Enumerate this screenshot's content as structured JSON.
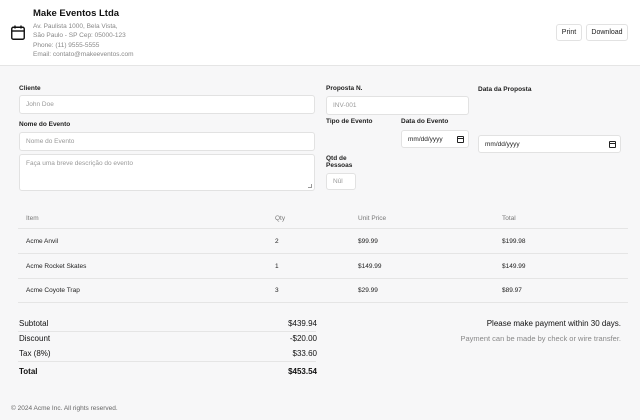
{
  "company": {
    "name": "Make Eventos Ltda",
    "address_line1": "Av. Paulista 1000, Bela Vista,",
    "address_line2": "São Paulo - SP Cep: 05000-123",
    "phone": "Phone: (11) 9555-5555",
    "email": "Email: contato@makeeventos.com"
  },
  "toolbar": {
    "print_label": "Print",
    "download_label": "Download"
  },
  "form": {
    "cliente_label": "Cliente",
    "cliente_placeholder": "John Doe",
    "evento_label": "Nome do Evento",
    "evento_placeholder": "Nome do Evento",
    "descricao_placeholder": "Faça uma breve descrição do evento",
    "proposta_label": "Proposta N.",
    "proposta_placeholder": "INV-001",
    "data_proposta_label": "Data da Proposta",
    "tipo_label": "Tipo de Evento",
    "data_evento_label": "Data do Evento",
    "qtd_label_line1": "Qtd de",
    "qtd_label_line2": "Pessoas",
    "qtd_placeholder": "Nûl",
    "date_placeholder": "mm/dd/yyyy"
  },
  "table": {
    "headers": [
      "Item",
      "Qty",
      "Unit Price",
      "Total"
    ],
    "rows": [
      [
        "Acme Anvil",
        "2",
        "$99.99",
        "$199.98"
      ],
      [
        "Acme Rocket Skates",
        "1",
        "$149.99",
        "$149.99"
      ],
      [
        "Acme Coyote Trap",
        "3",
        "$29.99",
        "$89.97"
      ]
    ]
  },
  "summary": {
    "subtotal_label": "Subtotal",
    "subtotal": "$439.94",
    "discount_label": "Discount",
    "discount": "-$20.00",
    "tax_label": "Tax (8%)",
    "tax": "$33.60",
    "total_label": "Total",
    "total": "$453.54"
  },
  "notes": {
    "payment_terms": "Please make payment within 30 days.",
    "payment_methods": "Payment can be made by check or wire transfer."
  },
  "footer": {
    "copyright": "© 2024 Acme Inc. All rights reserved."
  }
}
